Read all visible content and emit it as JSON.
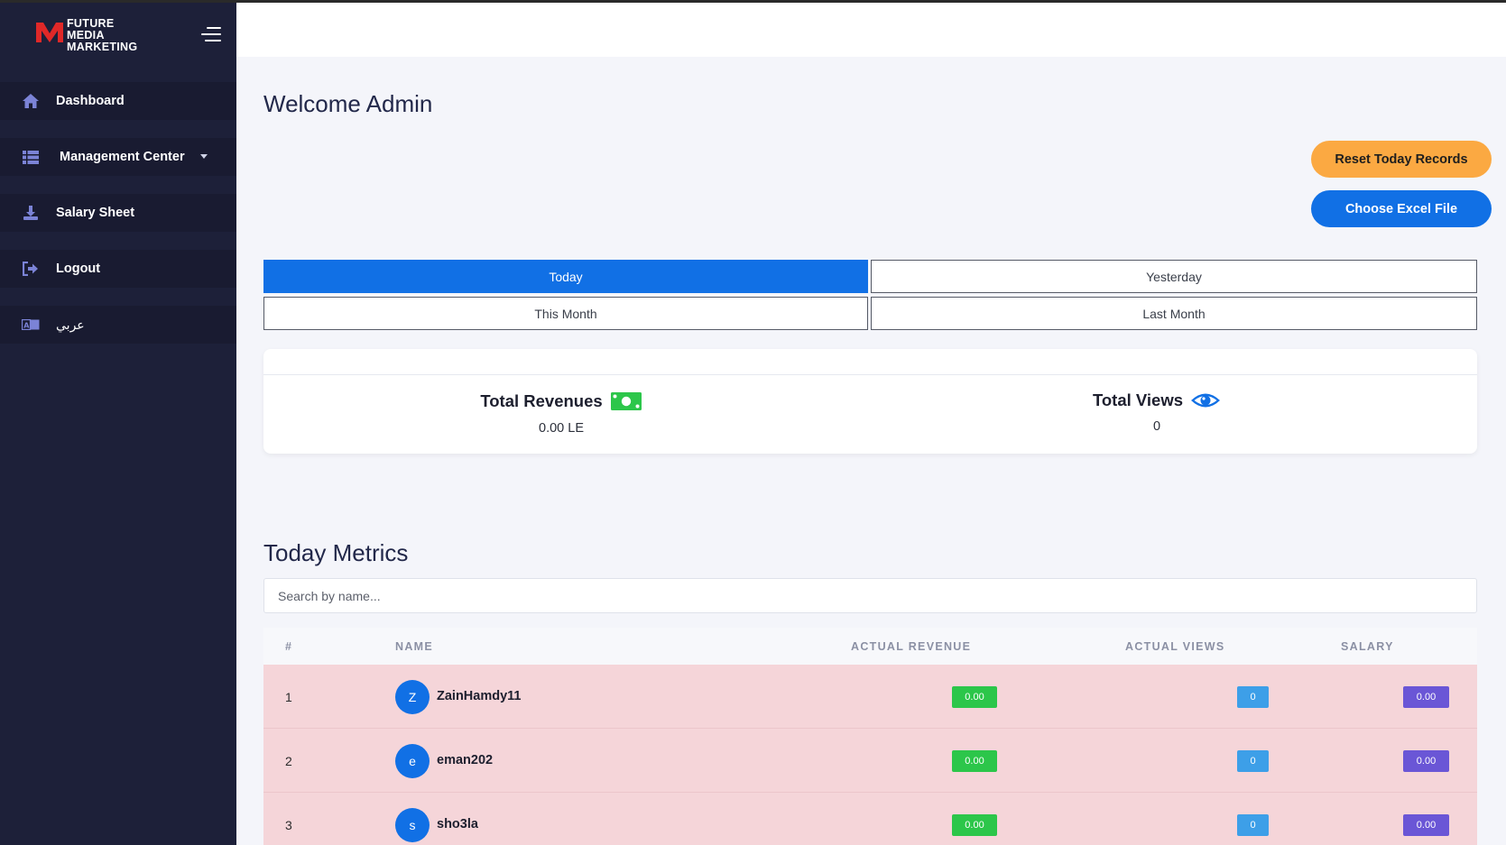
{
  "brand": {
    "line1": "FUTURE",
    "line2": "MEDIA",
    "line3": "MARKETING",
    "logo_icon": "fm-logo-icon",
    "menu_icon": "hamburger-menu-icon"
  },
  "sidebar": {
    "items": [
      {
        "label": "Dashboard",
        "icon": "home-icon"
      },
      {
        "label": "Management Center",
        "icon": "list-icon",
        "has_dropdown": true
      },
      {
        "label": "Salary Sheet",
        "icon": "download-icon"
      },
      {
        "label": "Logout",
        "icon": "logout-icon"
      },
      {
        "label": "عربي",
        "icon": "language-icon"
      }
    ]
  },
  "main": {
    "welcome": "Welcome Admin",
    "buttons": {
      "reset": "Reset Today Records",
      "excel": "Choose Excel File"
    },
    "filters": {
      "today": "Today",
      "yesterday": "Yesterday",
      "this_month": "This Month",
      "last_month": "Last Month",
      "active": "Today"
    },
    "stats": {
      "revenues": {
        "title": "Total Revenues",
        "value": "0.00 LE",
        "icon": "money-bill-icon"
      },
      "views": {
        "title": "Total Views",
        "value": "0",
        "icon": "eye-icon"
      }
    },
    "metrics_title": "Today Metrics",
    "search": {
      "placeholder": "Search by name...",
      "value": ""
    },
    "table": {
      "headers": {
        "index": "#",
        "name": "NAME",
        "revenue": "ACTUAL REVENUE",
        "views": "ACTUAL VIEWS",
        "salary": "SALARY"
      },
      "rows": [
        {
          "index": "1",
          "initial": "Z",
          "name": "ZainHamdy11",
          "revenue": "0.00",
          "views": "0",
          "salary": "0.00"
        },
        {
          "index": "2",
          "initial": "e",
          "name": "eman202",
          "revenue": "0.00",
          "views": "0",
          "salary": "0.00"
        },
        {
          "index": "3",
          "initial": "s",
          "name": "sho3la",
          "revenue": "0.00",
          "views": "0",
          "salary": "0.00"
        }
      ]
    }
  },
  "colors": {
    "sidebar_bg": "#1d2039",
    "primary": "#1170e5",
    "reset_orange": "#fba942",
    "row_bg": "#f5d5d9",
    "badge_revenue": "#2cc64a",
    "badge_views": "#3d9fe8",
    "badge_salary": "#6a56d6"
  }
}
